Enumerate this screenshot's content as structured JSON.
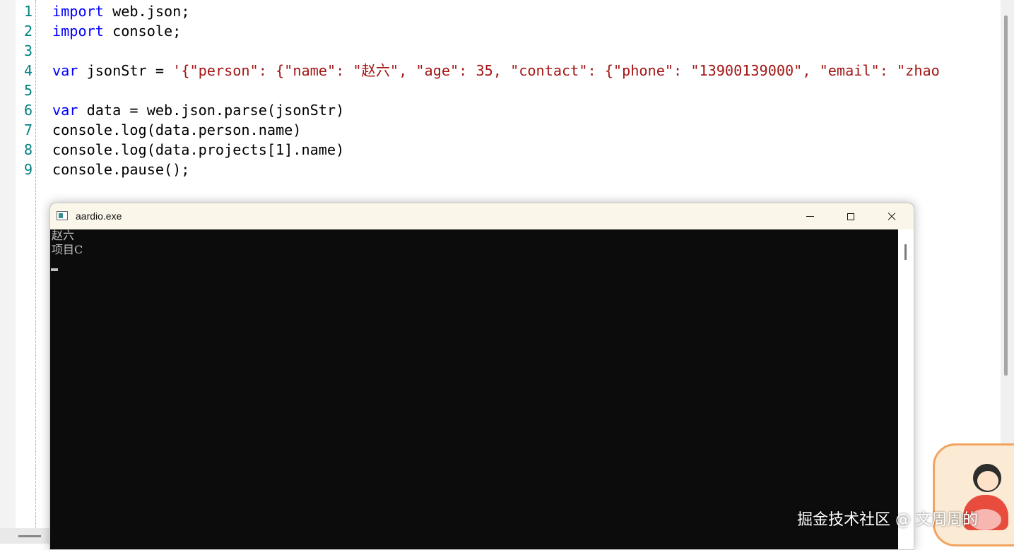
{
  "editor": {
    "line_numbers": [
      "1",
      "2",
      "3",
      "4",
      "5",
      "6",
      "7",
      "8",
      "9"
    ],
    "lines": [
      {
        "kw": "import",
        "text": " web.json;"
      },
      {
        "kw": "import",
        "text": " console;"
      },
      {
        "kw": "",
        "text": ""
      },
      {
        "kw": "var",
        "text": " jsonStr = ",
        "str": "'{\"person\": {\"name\": \"赵六\", \"age\": 35, \"contact\": {\"phone\": \"13900139000\", \"email\": \"zhao"
      },
      {
        "kw": "",
        "text": ""
      },
      {
        "kw": "var",
        "text": " data = web.json.parse(jsonStr)"
      },
      {
        "kw": "",
        "text": "console.log(data.person.name)"
      },
      {
        "kw": "",
        "text": "console.log(data.projects[1].name)"
      },
      {
        "kw": "",
        "text": "console.pause();"
      }
    ]
  },
  "console": {
    "title": "aardio.exe",
    "output": [
      "赵六",
      "项目C"
    ]
  },
  "watermark": "掘金技术社区 @ 文周周的"
}
